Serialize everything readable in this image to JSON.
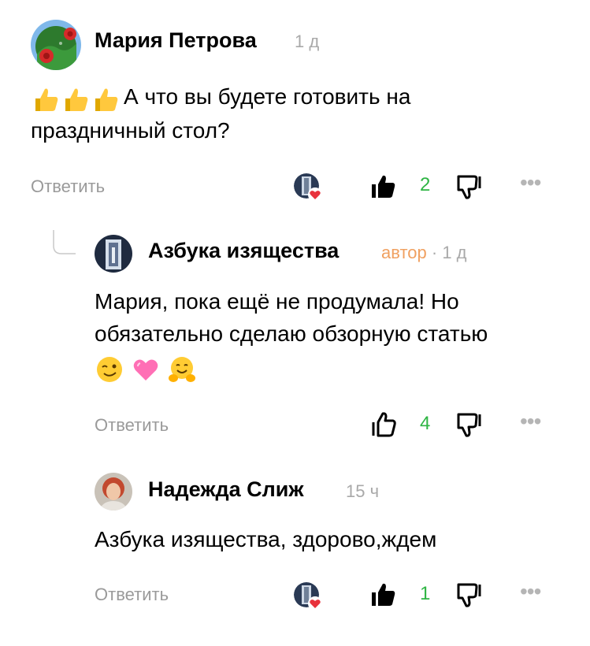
{
  "comments": [
    {
      "author": "Мария Петрова",
      "time": "1 д",
      "text": "А что вы будете готовить на праздничный стол?",
      "text_line1": "А что вы будете готовить на",
      "text_line2": "праздничный стол?",
      "emoji_prefix": [
        "thumbs-up",
        "thumbs-up",
        "thumbs-up"
      ],
      "reply_label": "Ответить",
      "likes": "2",
      "liked_by_author": true
    },
    {
      "author": "Азбука изящества",
      "author_tag": "автор",
      "time": "1 д",
      "text_line1": "Мария, пока ещё не продумала! Но",
      "text_line2": "обязательно сделаю обзорную статью",
      "emoji_suffix": [
        "winking-face",
        "pink-heart",
        "hugging-face"
      ],
      "reply_label": "Ответить",
      "likes": "4",
      "liked_by_author": false
    },
    {
      "author": "Надежда Слиж",
      "time": "15 ч",
      "text": "Азбука изящества, здорово,ждем",
      "reply_label": "Ответить",
      "likes": "1",
      "liked_by_author": true
    }
  ],
  "colors": {
    "like_count": "#2fb544",
    "author_tag": "#f0a060",
    "muted": "#9a9a9a",
    "heart": "#e8323c"
  },
  "icons": [
    "thumbs-up-filled-icon",
    "thumbs-up-outline-icon",
    "thumbs-down-icon",
    "more-dots-icon",
    "thread-line-icon",
    "heart-badge-icon"
  ]
}
